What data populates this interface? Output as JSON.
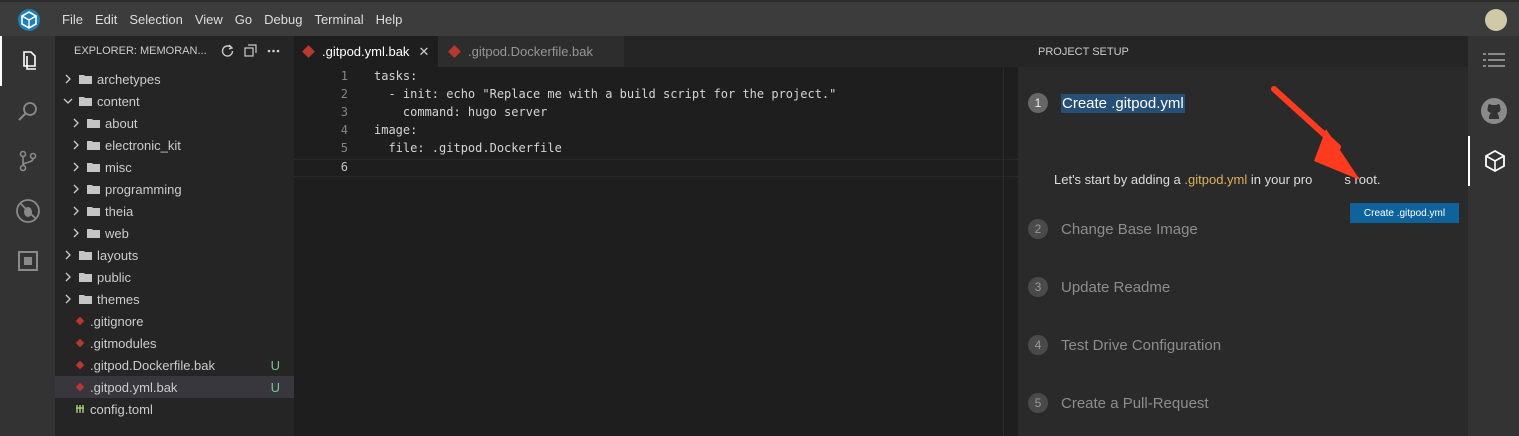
{
  "menu": [
    "File",
    "Edit",
    "Selection",
    "View",
    "Go",
    "Debug",
    "Terminal",
    "Help"
  ],
  "activity_icons": [
    "files-icon",
    "search-icon",
    "source-control-icon",
    "debug-icon",
    "extensions-icon"
  ],
  "explorer": {
    "title": "EXPLORER: MEMORAN...",
    "tree": [
      {
        "label": "archetypes",
        "type": "folder",
        "open": false,
        "depth": 0
      },
      {
        "label": "content",
        "type": "folder",
        "open": true,
        "depth": 0
      },
      {
        "label": "about",
        "type": "folder",
        "open": false,
        "depth": 1
      },
      {
        "label": "electronic_kit",
        "type": "folder",
        "open": false,
        "depth": 1
      },
      {
        "label": "misc",
        "type": "folder",
        "open": false,
        "depth": 1
      },
      {
        "label": "programming",
        "type": "folder",
        "open": false,
        "depth": 1
      },
      {
        "label": "theia",
        "type": "folder",
        "open": false,
        "depth": 1
      },
      {
        "label": "web",
        "type": "folder",
        "open": false,
        "depth": 1
      },
      {
        "label": "layouts",
        "type": "folder",
        "open": false,
        "depth": 0
      },
      {
        "label": "public",
        "type": "folder",
        "open": false,
        "depth": 0
      },
      {
        "label": "themes",
        "type": "folder",
        "open": false,
        "depth": 0
      },
      {
        "label": ".gitignore",
        "type": "git-file",
        "depth": 0
      },
      {
        "label": ".gitmodules",
        "type": "git-file",
        "depth": 0
      },
      {
        "label": ".gitpod.Dockerfile.bak",
        "type": "git-file",
        "depth": 0,
        "badge": "U"
      },
      {
        "label": ".gitpod.yml.bak",
        "type": "git-file",
        "depth": 0,
        "badge": "U",
        "selected": true
      },
      {
        "label": "config.toml",
        "type": "toml-file",
        "depth": 0
      }
    ]
  },
  "tabs": [
    {
      "label": ".gitpod.yml.bak",
      "active": true
    },
    {
      "label": ".gitpod.Dockerfile.bak",
      "active": false
    }
  ],
  "code_lines": [
    "tasks:",
    "  - init: echo \"Replace me with a build script for the project.\"",
    "    command: hugo server",
    "image:",
    "  file: .gitpod.Dockerfile",
    ""
  ],
  "current_line": 6,
  "setup": {
    "title": "PROJECT SETUP",
    "steps": [
      {
        "num": "1",
        "title": "Create .gitpod.yml",
        "active": true
      },
      {
        "num": "2",
        "title": "Change Base Image"
      },
      {
        "num": "3",
        "title": "Update Readme"
      },
      {
        "num": "4",
        "title": "Test Drive Configuration"
      },
      {
        "num": "5",
        "title": "Create a Pull-Request"
      }
    ],
    "desc_pre": "Let's start by adding a ",
    "desc_hl": ".gitpod.yml",
    "desc_post": " in your pro",
    "desc_tail": "s root.",
    "button": "Create .gitpod.yml"
  },
  "right_icons": [
    "outline-icon",
    "github-icon",
    "gitpod-icon"
  ],
  "colors": {
    "accent": "#0e639c",
    "arrow": "#ff3b1f",
    "badge": "#73c991"
  }
}
